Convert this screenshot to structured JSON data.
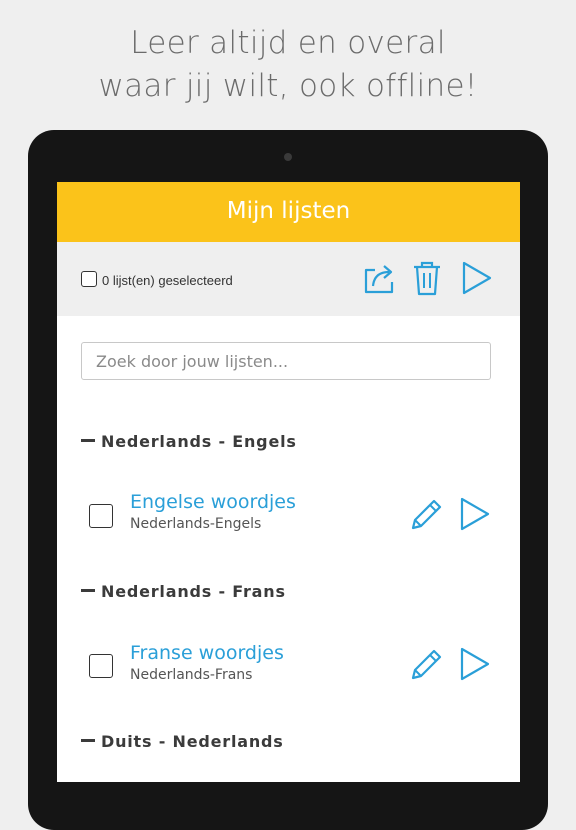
{
  "promo": {
    "line1": "Leer altijd en overal",
    "line2": "waar jij wilt, ook offline!"
  },
  "app": {
    "title": "Mijn lijsten",
    "accent_color": "#fbc31a",
    "link_color": "#2a9fd8"
  },
  "toolbar": {
    "selection_label": "0 lijst(en) geselecteerd",
    "icons": [
      "share-icon",
      "trash-icon",
      "play-icon"
    ]
  },
  "search": {
    "placeholder": "Zoek door jouw lijsten..."
  },
  "groups": [
    {
      "name": "Nederlands - Engels",
      "lists": [
        {
          "title": "Engelse woordjes",
          "subtitle": "Nederlands-Engels"
        }
      ]
    },
    {
      "name": "Nederlands - Frans",
      "lists": [
        {
          "title": "Franse woordjes",
          "subtitle": "Nederlands-Frans"
        }
      ]
    },
    {
      "name": "Duits - Nederlands",
      "lists": []
    }
  ]
}
